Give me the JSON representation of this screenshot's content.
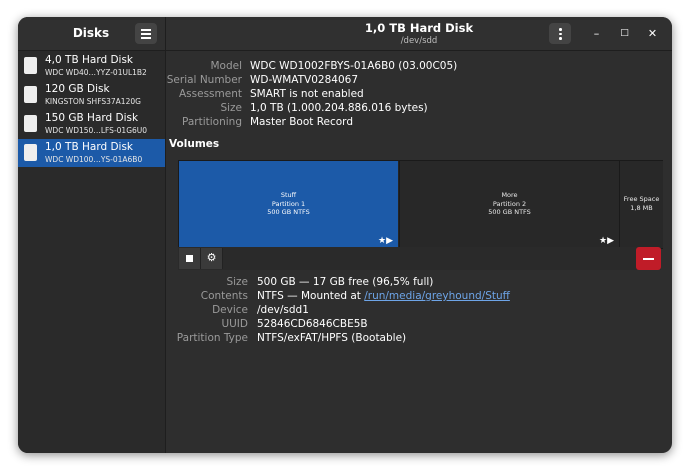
{
  "sidebar": {
    "title": "Disks",
    "disks": [
      {
        "name": "4,0 TB Hard Disk",
        "model": "WDC WD40…YYZ-01UL1B2"
      },
      {
        "name": "120 GB Disk",
        "model": "KINGSTON SHFS37A120G"
      },
      {
        "name": "150 GB Hard Disk",
        "model": "WDC WD150…LFS-01G6U0"
      },
      {
        "name": "1,0 TB Hard Disk",
        "model": "WDC WD100…YS-01A6B0",
        "selected": true
      }
    ]
  },
  "header": {
    "title": "1,0 TB Hard Disk",
    "subtitle": "/dev/sdd",
    "minimize": "–",
    "maximize": "□",
    "close": "✕"
  },
  "disk_info": {
    "model_label": "Model",
    "model": "WDC WD1002FBYS-01A6B0 (03.00C05)",
    "serial_label": "Serial Number",
    "serial": "WD-WMATV0284067",
    "assessment_label": "Assessment",
    "assessment": "SMART is not enabled",
    "size_label": "Size",
    "size": "1,0 TB (1.000.204.886.016 bytes)",
    "partitioning_label": "Partitioning",
    "partitioning": "Master Boot Record"
  },
  "volumes": {
    "title": "Volumes",
    "partitions": [
      {
        "name": "Stuff",
        "number": "Partition 1",
        "size": "500 GB NTFS",
        "flags": "★▶",
        "selected": true
      },
      {
        "name": "More",
        "number": "Partition 2",
        "size": "500 GB NTFS",
        "flags": "★▶"
      },
      {
        "name": "Free Space",
        "size": "1,8 MB"
      }
    ],
    "toolbar": {
      "stop_icon": "stop-icon",
      "settings_icon": "gear-icon",
      "delete_icon": "minus-icon"
    }
  },
  "partition_info": {
    "size_label": "Size",
    "size": "500 GB — 17 GB free (96,5% full)",
    "contents_label": "Contents",
    "contents_prefix": "NTFS — Mounted at ",
    "contents_link": "/run/media/greyhound/Stuff",
    "device_label": "Device",
    "device": "/dev/sdd1",
    "uuid_label": "UUID",
    "uuid": "52846CD6846CBE5B",
    "type_label": "Partition Type",
    "type": "NTFS/exFAT/HPFS (Bootable)"
  },
  "colors": {
    "accent": "#1c5aa8",
    "destructive": "#c01c28",
    "link": "#6ea5e8"
  }
}
